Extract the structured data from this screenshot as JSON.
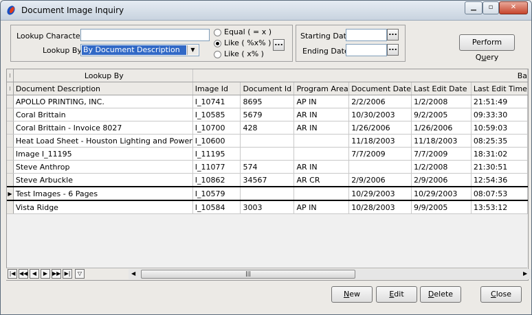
{
  "window": {
    "title": "Document Image Inquiry"
  },
  "lookup": {
    "characters_label": "Lookup Characters",
    "characters_value": "",
    "by_label": "Lookup By",
    "by_value": "By Document Description",
    "radio": [
      {
        "label": "Equal ( = x )",
        "checked": false
      },
      {
        "label": "Like ( %x% )",
        "checked": true
      },
      {
        "label": "Like ( x% )",
        "checked": false
      }
    ]
  },
  "dates": {
    "start_label": "Starting Date",
    "start_value": "",
    "end_label": "Ending Date",
    "end_value": ""
  },
  "query_button": {
    "pre": "Perform Q",
    "accel": "u",
    "post": "ery"
  },
  "grid": {
    "group_header": "Lookup By",
    "group_header_right": "Ba",
    "columns": [
      "Document Description",
      "Image Id",
      "Document Id",
      "Program Area",
      "Document Date",
      "Last Edit Date",
      "Last Edit Time"
    ],
    "rows": [
      [
        "APOLLO PRINTING, INC.",
        "I_10741",
        "8695",
        "AP IN",
        "2/2/2006",
        "1/2/2008",
        "21:51:49"
      ],
      [
        "Coral Brittain",
        "I_10585",
        "5679",
        "AR IN",
        "10/30/2003",
        "9/2/2005",
        "09:33:30"
      ],
      [
        "Coral Brittain - Invoice 8027",
        "I_10700",
        "428",
        "AR IN",
        "1/26/2006",
        "1/26/2006",
        "10:59:03"
      ],
      [
        "Heat Load Sheet - Houston Lighting and Power",
        "I_10600",
        "",
        "",
        "11/18/2003",
        "11/18/2003",
        "08:25:35"
      ],
      [
        "Image I_11195",
        "I_11195",
        "",
        "",
        "7/7/2009",
        "7/7/2009",
        "18:31:02"
      ],
      [
        "Steve Anthrop",
        "I_11077",
        "574",
        "AR IN",
        "",
        "1/2/2008",
        "21:30:51"
      ],
      [
        "Steve Arbuckle",
        "I_10862",
        "34567",
        "AR CR",
        "2/9/2006",
        "2/9/2006",
        "12:54:36"
      ],
      [
        "Test Images - 6 Pages",
        "I_10579",
        "",
        "",
        "10/29/2003",
        "10/29/2003",
        "08:07:53"
      ],
      [
        "Vista Ridge",
        "I_10584",
        "3003",
        "AP IN",
        "10/28/2003",
        "9/9/2005",
        "13:53:12"
      ]
    ],
    "current_row": 7
  },
  "buttons": [
    {
      "pre": "",
      "accel": "N",
      "post": "ew"
    },
    {
      "pre": "",
      "accel": "E",
      "post": "dit"
    },
    {
      "pre": "",
      "accel": "D",
      "post": "elete"
    },
    {
      "pre": "",
      "accel": "C",
      "post": "lose"
    }
  ],
  "icons": {
    "app": "document-app-icon"
  }
}
